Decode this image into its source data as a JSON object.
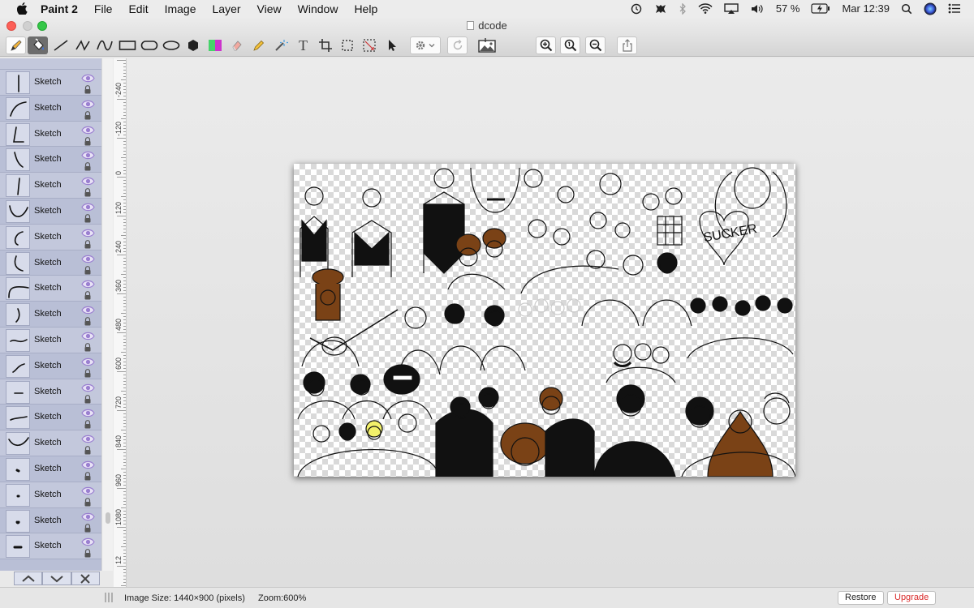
{
  "menubar": {
    "app_name": "Paint 2",
    "items": [
      "File",
      "Edit",
      "Image",
      "Layer",
      "View",
      "Window",
      "Help"
    ],
    "battery": "57 %",
    "clock": "Mar 12:39"
  },
  "window": {
    "title": "dcode"
  },
  "toolbar": {
    "tools": [
      "pen-tool",
      "fill-tool",
      "line-tool",
      "polyline-tool",
      "curve-tool",
      "rectangle-tool",
      "rounded-rectangle-tool",
      "ellipse-tool",
      "polygon-tool",
      "color-swatch",
      "eraser-tool",
      "pencil-tool",
      "magic-wand-tool",
      "text-tool",
      "crop-tool",
      "rect-select-tool",
      "lasso-select-tool",
      "pointer-tool"
    ],
    "text_tool_glyph": "T",
    "active_tool": "fill-tool",
    "swatch_colors": [
      "#46d36a",
      "#cc33cc"
    ]
  },
  "layers": {
    "items": [
      {
        "label": "Sketch"
      },
      {
        "label": "Sketch"
      },
      {
        "label": "Sketch"
      },
      {
        "label": "Sketch"
      },
      {
        "label": "Sketch"
      },
      {
        "label": "Sketch"
      },
      {
        "label": "Sketch"
      },
      {
        "label": "Sketch"
      },
      {
        "label": "Sketch"
      },
      {
        "label": "Sketch"
      },
      {
        "label": "Sketch"
      },
      {
        "label": "Sketch"
      },
      {
        "label": "Sketch"
      },
      {
        "label": "Sketch"
      },
      {
        "label": "Sketch"
      },
      {
        "label": "Sketch"
      },
      {
        "label": "Sketch"
      },
      {
        "label": "Sketch"
      },
      {
        "label": "Sketch"
      }
    ],
    "nav": [
      "move-up",
      "move-down",
      "delete"
    ]
  },
  "ruler": {
    "labels": [
      "-240",
      "-120",
      "0",
      "120",
      "240",
      "360",
      "480",
      "600",
      "720",
      "840",
      "960",
      "1080",
      "12"
    ]
  },
  "statusbar": {
    "image_size": "Image Size: 1440×900 (pixels)",
    "zoom": "Zoom:600%",
    "restore": "Restore",
    "upgrade": "Upgrade"
  },
  "colors": {
    "layer_panel": "#b9bfd6",
    "eye": "#9a7fd0",
    "upgrade_text": "#d92a2a"
  }
}
